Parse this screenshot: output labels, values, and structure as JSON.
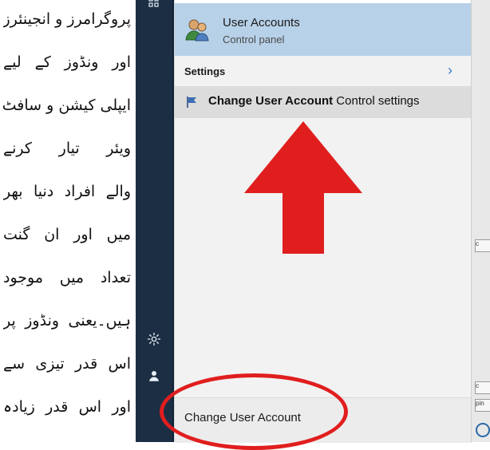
{
  "article": {
    "lines": [
      "پروگرامرز و انجینئرز",
      "اور ونڈوز کے لیے",
      "ایپلی کیشن و سافٹ",
      "ویئر تیار کرنے",
      "والے افراد دنیا بھر",
      "میں اور ان گنت",
      "تعداد میں موجود",
      "ہیں۔یعنی ونڈوز پر",
      "اس قدر تیزی سے",
      "اور اس قدر زیادہ"
    ]
  },
  "start_menu": {
    "rail_icons": [
      "apps-icon",
      "settings-gear-icon",
      "person-icon"
    ],
    "best_match": {
      "title": "User Accounts",
      "subtitle": "Control panel",
      "icon": "users-icon"
    },
    "settings_header": "Settings",
    "settings_result": {
      "bold_part": "Change User Account",
      "rest": " Control settings",
      "icon": "flag-icon"
    },
    "search_box_text": "Change User Account"
  },
  "background_window": {
    "labels": [
      "c",
      "c",
      "pin"
    ]
  },
  "annotations": {
    "arrow_color": "#e01e1e",
    "ellipse_color": "#e01e1e"
  }
}
